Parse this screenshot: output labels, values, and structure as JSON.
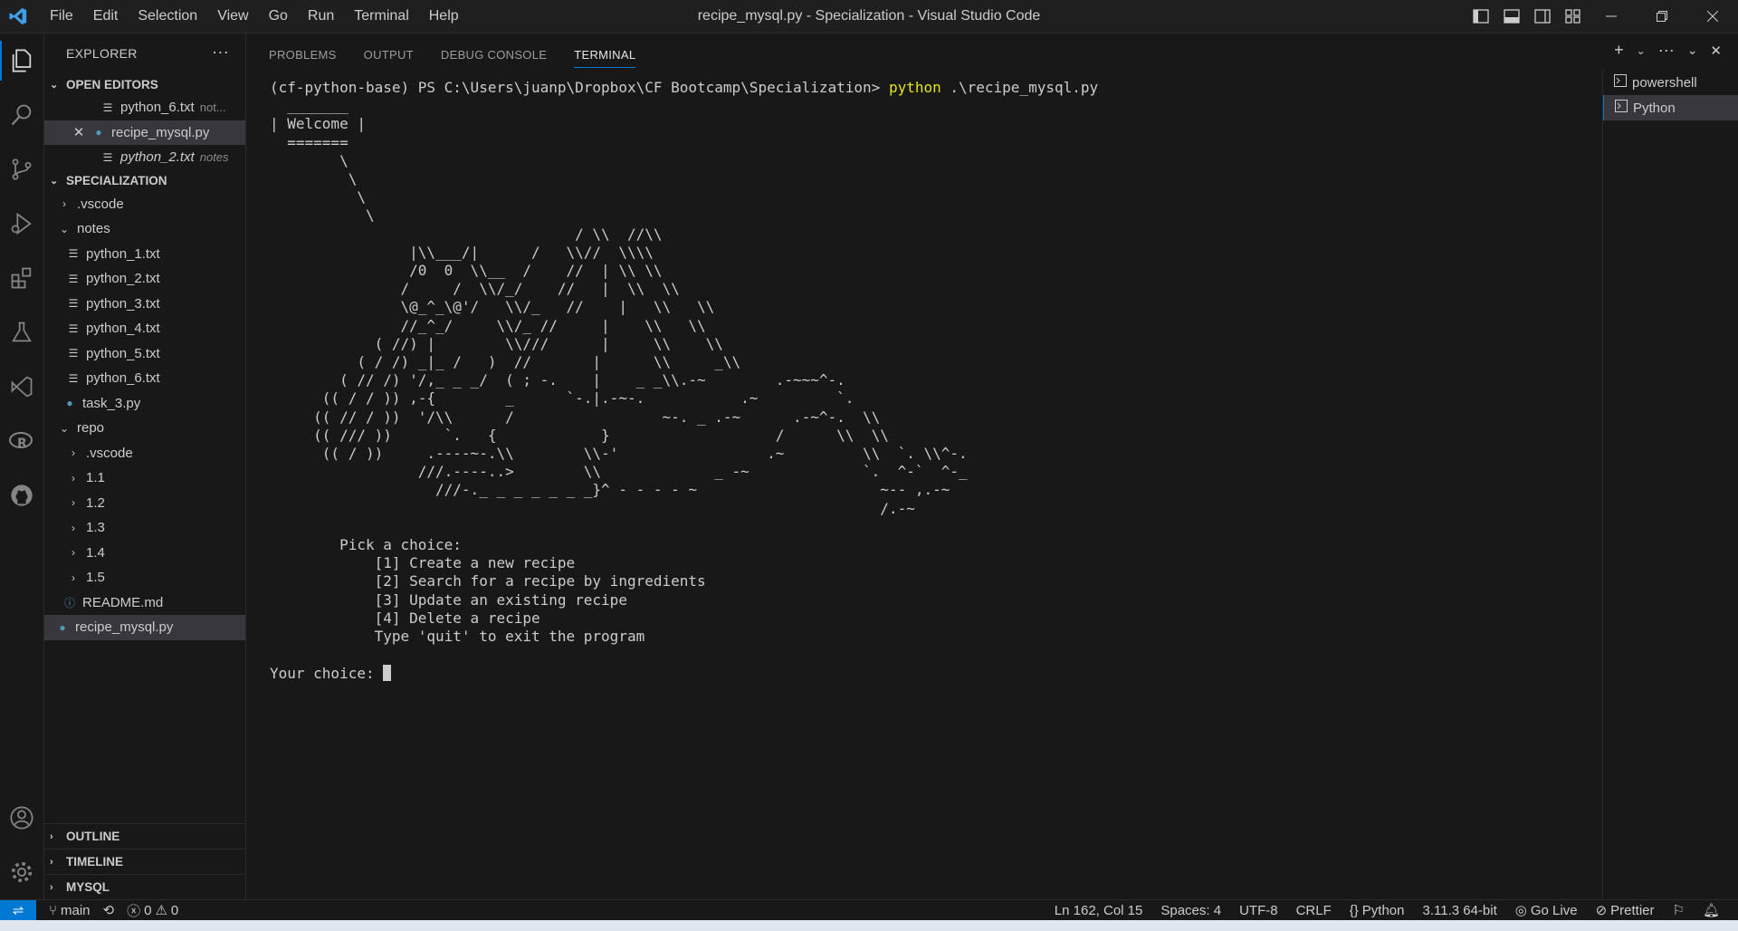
{
  "titlebar": {
    "menu": [
      "File",
      "Edit",
      "Selection",
      "View",
      "Go",
      "Run",
      "Terminal",
      "Help"
    ],
    "title": "recipe_mysql.py - Specialization - Visual Studio Code"
  },
  "sidebar": {
    "header": "EXPLORER",
    "open_editors": {
      "title": "OPEN EDITORS",
      "items": [
        {
          "label": "python_6.txt",
          "desc": "not..."
        },
        {
          "label": "recipe_mysql.py",
          "desc": ""
        },
        {
          "label": "python_2.txt",
          "desc": "notes"
        }
      ]
    },
    "workspace": {
      "title": "SPECIALIZATION",
      "items": [
        ".vscode",
        "notes",
        "python_1.txt",
        "python_2.txt",
        "python_3.txt",
        "python_4.txt",
        "python_5.txt",
        "python_6.txt",
        "task_3.py",
        "repo",
        ".vscode",
        "1.1",
        "1.2",
        "1.3",
        "1.4",
        "1.5",
        "README.md",
        "recipe_mysql.py"
      ]
    },
    "bottom_sections": [
      "OUTLINE",
      "TIMELINE",
      "MYSQL"
    ]
  },
  "panel": {
    "tabs": [
      "PROBLEMS",
      "OUTPUT",
      "DEBUG CONSOLE",
      "TERMINAL"
    ],
    "terminal": {
      "prompt": "(cf-python-base) PS C:\\Users\\juanp\\Dropbox\\CF Bootcamp\\Specialization> ",
      "command": "python",
      "args": " .\\recipe_mysql.py",
      "art": "  _______\n| Welcome |\n  =======\n        \\\n         \\\n          \\\n           \\\n                                   / \\\\  //\\\\\n                |\\\\___/|      /   \\\\//  \\\\\\\\\n                /0  0  \\\\__  /    //  | \\\\ \\\\\n               /     /  \\\\/_/    //   |  \\\\  \\\\\n               \\@_^_\\@'/   \\\\/_   //    |   \\\\   \\\\\n               //_^_/     \\\\/_ //     |    \\\\   \\\\\n            ( //) |        \\\\///      |     \\\\    \\\\\n          ( / /) _|_ /   )  //       |      \\\\     _\\\\\n        ( // /) '/,_ _ _/  ( ; -.    |    _ _\\\\.-~        .-~~~^-.\n      (( / / )) ,-{        _      `-.|.-~-.           .~         `.\n     (( // / ))  '/\\\\      /                 ~-. _ .-~      .-~^-.  \\\\\n     (( /// ))      `.   {            }                   /      \\\\  \\\\\n      (( / ))     .----~-.\\\\        \\\\-'                 .~         \\\\  `. \\\\^-.\n                 ///.----..>        \\\\             _ -~             `.  ^-`  ^-_\n                   ///-._ _ _ _ _ _ _}^ - - - - ~                     ~-- ,.-~\n                                                                      /.-~",
      "menu": "        Pick a choice:\n            [1] Create a new recipe\n            [2] Search for a recipe by ingredients\n            [3] Update an existing recipe\n            [4] Delete a recipe\n            Type 'quit' to exit the program",
      "input_prompt": "Your choice: "
    },
    "terminal_list": [
      "powershell",
      "Python"
    ]
  },
  "statusbar": {
    "branch": "main",
    "errors": "0",
    "warnings": "0",
    "position": "Ln 162, Col 15",
    "spaces": "Spaces: 4",
    "encoding": "UTF-8",
    "eol": "CRLF",
    "language": "Python",
    "interpreter": "3.11.3 64-bit",
    "golive": "Go Live",
    "prettier": "Prettier"
  },
  "colors": {
    "accent": "#0078d4",
    "command": "#e5e510",
    "python_icon": "#519aba"
  }
}
